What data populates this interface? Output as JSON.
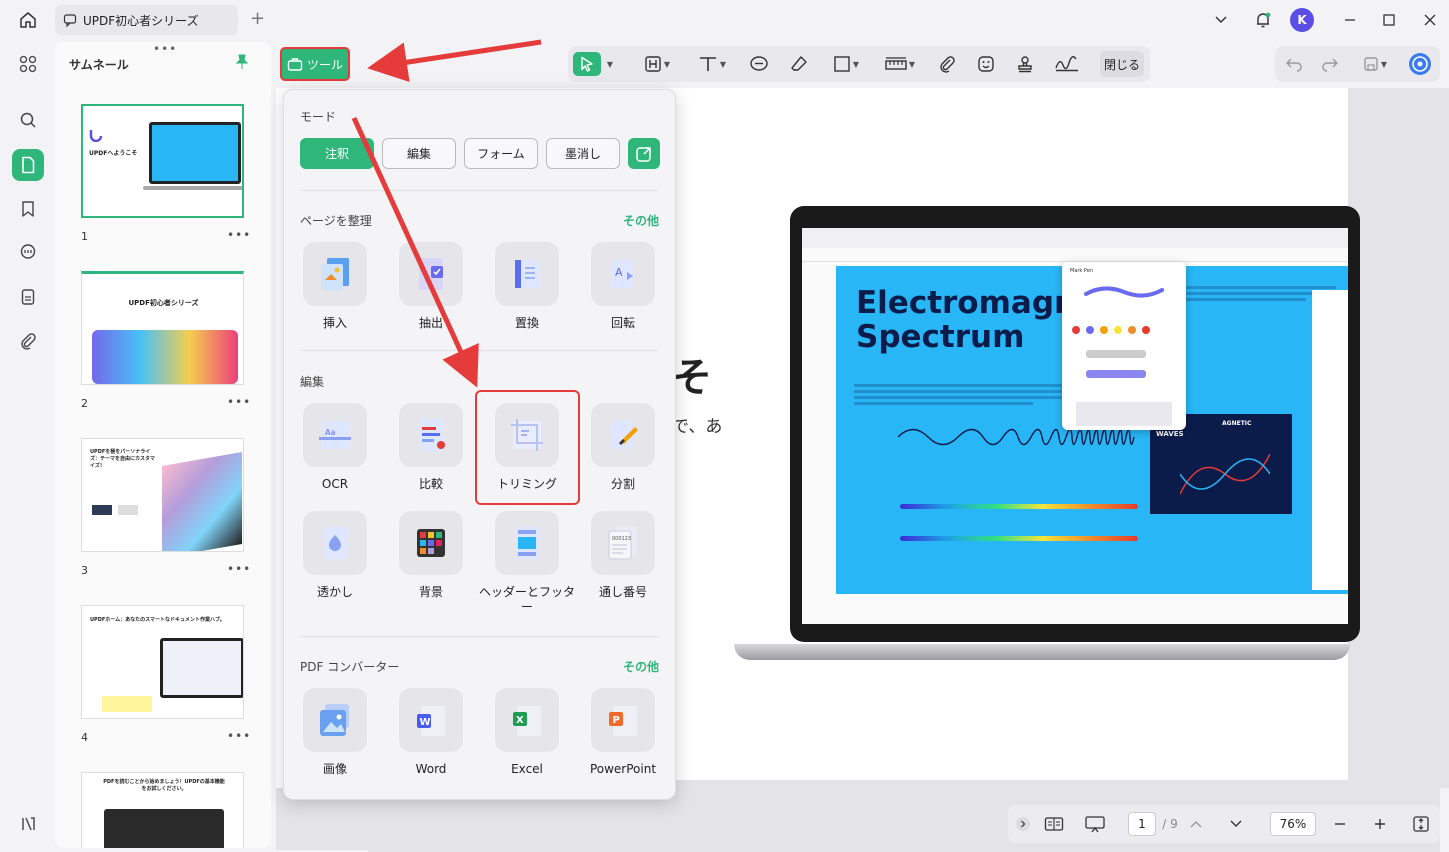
{
  "tab": {
    "title": "UPDF初心者シリーズ"
  },
  "avatar": {
    "initial": "K"
  },
  "thumbnails": {
    "header": "サムネール",
    "pages": [
      {
        "num": "1",
        "caption": "UPDFへようこそ"
      },
      {
        "num": "2",
        "caption": "UPDF初心者シリーズ"
      },
      {
        "num": "3",
        "caption": "UPDFを極をパーソナライズ：テーマを自由にカスタマイズ！"
      },
      {
        "num": "4",
        "caption": "UPDFホーム：あなたのスマートなドキュメント作業ハブ。"
      },
      {
        "num": "",
        "caption": "PDFを読むことから始めましょう！UPDFの基本機能をお試しください。"
      }
    ]
  },
  "toolbar": {
    "tools_label": "ツール",
    "close_label": "閉じる"
  },
  "dropdown": {
    "mode_title": "モード",
    "modes": [
      "注釈",
      "編集",
      "フォーム",
      "墨消し"
    ],
    "organize_title": "ページを整理",
    "organize_more": "その他",
    "organize_items": [
      "挿入",
      "抽出",
      "置換",
      "回転"
    ],
    "edit_title": "編集",
    "edit_items": [
      "OCR",
      "比較",
      "トリミング",
      "分割",
      "透かし",
      "背景",
      "ヘッダーとフッター",
      "通し番号"
    ],
    "converter_title": "PDF コンバーター",
    "converter_more": "その他",
    "converter_items": [
      "画像",
      "Word",
      "Excel",
      "PowerPoint"
    ]
  },
  "document": {
    "big_char": "そ",
    "small_text": "で、あ",
    "poster_title_1": "Electromagne",
    "poster_title_2": "Spectrum",
    "waves_label": "WAVES",
    "magnetic_label": "AGNETIC",
    "pen_panel_title": "Mark Pen"
  },
  "bottombar": {
    "page_current": "1",
    "page_total": "/ 9",
    "zoom": "76%"
  },
  "colors": {
    "accent": "#2fb67a",
    "highlight": "#e53b3b",
    "poster_bg": "#29b6f6"
  }
}
